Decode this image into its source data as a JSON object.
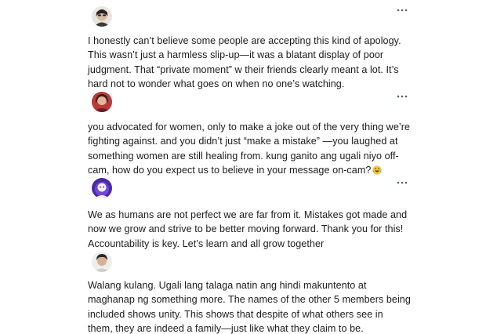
{
  "replies": [
    {
      "avatar_icon": "avatar-icon",
      "menu_icon": "more-options-icon",
      "lines": [
        "I honestly can’t believe some people are accepting this kind of apology.",
        "This wasn’t just a harmless slip-up—it was a blatant display of poor",
        "judgment. That “private moment” w their friends clearly meant a lot. It’s",
        "hard not to wonder what goes on when no one’s watching."
      ]
    },
    {
      "avatar_icon": "avatar-icon",
      "menu_icon": "more-options-icon",
      "lines": [
        "you advocated for women, only to make a joke out of the very thing we’re",
        "fighting against. and you didn’t just “make a mistake” —you laughed at",
        "something women are still healing from. kung ganito ang ugali niyo off-",
        "cam, how do you expect us to believe in your message on-cam?"
      ],
      "trailing_emoji": "laughing-crying-emoji-icon"
    },
    {
      "avatar_icon": "avatar-icon",
      "menu_icon": "more-options-icon",
      "lines": [
        "We as humans are not perfect we are far from it. Mistakes got made and",
        "now we grow and strive to be better moving forward. Thank you for this!",
        "Accountability is key. Let’s learn and all grow together"
      ]
    },
    {
      "avatar_icon": "avatar-icon",
      "lines": [
        "Walang kulang. Ugali lang talaga natin ang hindi makuntento at",
        "maghanap ng something more. The names of the other 5 members being",
        "included shows unity. This shows that despite of what others see in",
        "them, they are indeed a family—just like what they claim to be."
      ]
    }
  ],
  "colors": {
    "text": "#1b1b1b",
    "menu_dots": "#536471",
    "background": "#ffffff"
  }
}
